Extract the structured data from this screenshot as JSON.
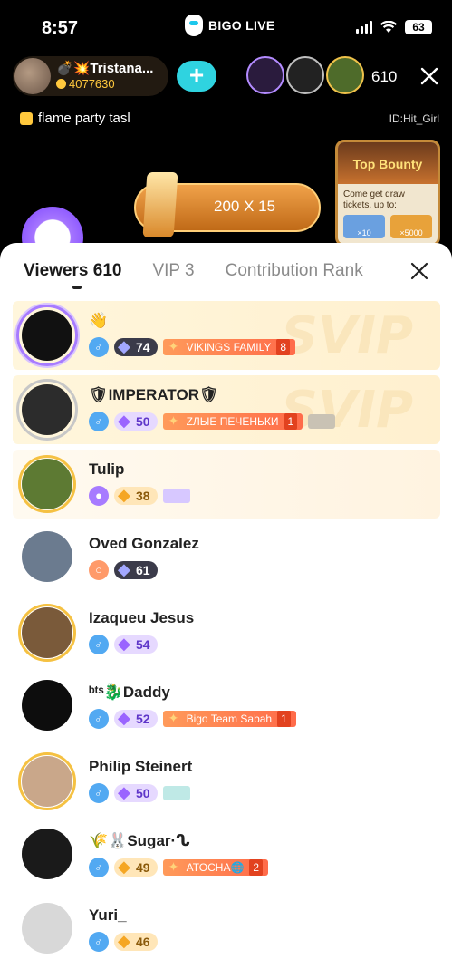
{
  "status": {
    "time": "8:57",
    "battery": "63",
    "brand": "BIGO LIVE"
  },
  "host": {
    "name": "💣💥Tristana...",
    "beans": "4077630"
  },
  "follow_label": "+",
  "top_viewers_count": "610",
  "task_text": "flame party tasl",
  "room_id": "ID:Hit_Girl",
  "gift_banner": "200 X 15",
  "bounty": {
    "title": "Top Bounty",
    "text": "Come get draw tickets, up to:",
    "prize1": "×10",
    "prize2": "×5000"
  },
  "tabs": [
    {
      "label": "Viewers 610"
    },
    {
      "label": "VIP 3"
    },
    {
      "label": "Contribution Rank"
    }
  ],
  "viewers": [
    {
      "name": "👋",
      "gender": "♂",
      "level": "74",
      "level_style": "dark",
      "family": "VIKINGS FAMILY",
      "family_rank": "8",
      "frame": "SVIP3"
    },
    {
      "name": "🛡IMPERATOR🛡",
      "gender": "♂",
      "level": "50",
      "level_style": "purple",
      "family": "ZЛЫЕ ПЕЧЕНЬКИ",
      "family_rank": "1",
      "frame": "СВИДА"
    },
    {
      "name": "Tulip",
      "gender": "♂",
      "level": "38",
      "level_style": "orange"
    },
    {
      "name": "Oved Gonzalez",
      "gender": "♂",
      "level": "61",
      "level_style": "dark"
    },
    {
      "name": "Izaqueu Jesus",
      "gender": "♂",
      "level": "54",
      "level_style": "purple"
    },
    {
      "name": "ᵇᵗˢ🐉Daddy",
      "gender": "♂",
      "level": "52",
      "level_style": "purple",
      "family": "Bigo Team Sabah",
      "family_rank": "1"
    },
    {
      "name": "Philip Steinert",
      "gender": "♂",
      "level": "50",
      "level_style": "purple"
    },
    {
      "name": "🌾🐰Sugar·ᔐ",
      "gender": "♂",
      "level": "49",
      "level_style": "orange",
      "family": "ATOCHA🌐",
      "family_rank": "2"
    },
    {
      "name": "Yuri_",
      "gender": "♂",
      "level": "46",
      "level_style": "orange"
    }
  ]
}
